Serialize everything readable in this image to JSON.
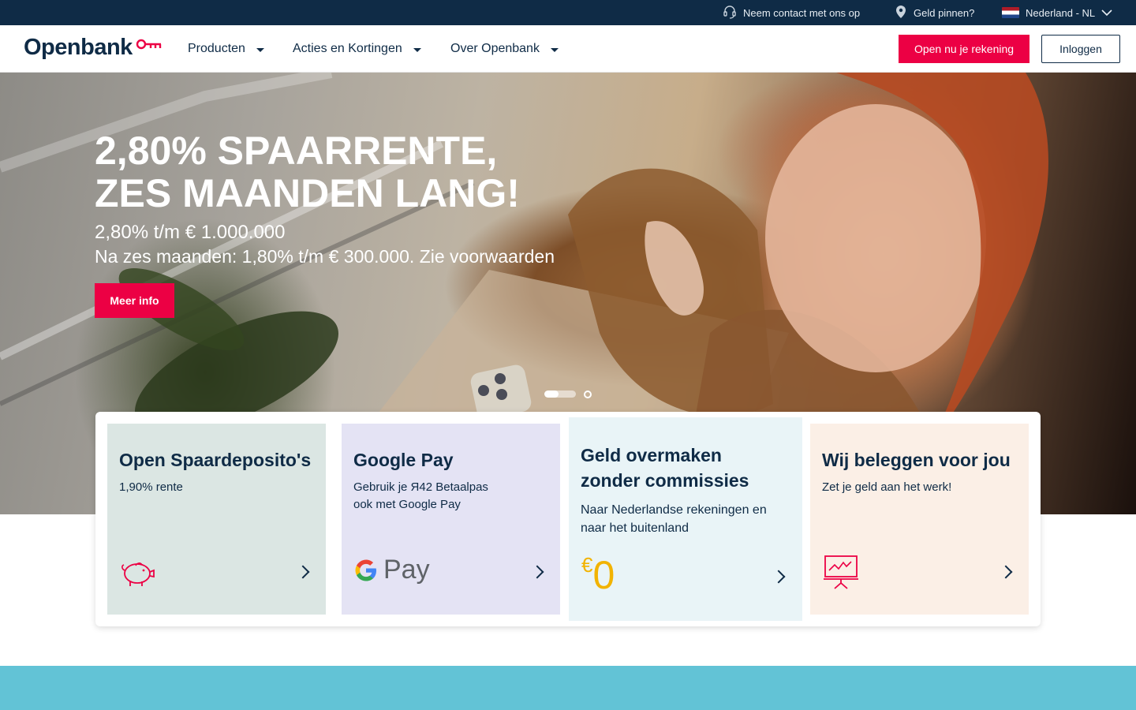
{
  "topbar": {
    "contact": "Neem contact met ons op",
    "atm": "Geld pinnen?",
    "language": "Nederland - NL"
  },
  "header": {
    "logo": "Openbank",
    "nav": [
      {
        "label": "Producten"
      },
      {
        "label": "Acties en Kortingen"
      },
      {
        "label": "Over Openbank"
      }
    ],
    "open_account": "Open nu je rekening",
    "login": "Inloggen"
  },
  "hero": {
    "title_line1": "2,80% SPAARRENTE,",
    "title_line2": "ZES MAANDEN LANG!",
    "subtitle1": "2,80% t/m € 1.000.000",
    "subtitle2": "Na zes maanden: 1,80% t/m € 300.000. Zie voorwaarden",
    "cta": "Meer info",
    "slides": 2,
    "active_slide": 1
  },
  "cards": [
    {
      "title": "Open Spaardeposito's",
      "text": "1,90% rente",
      "icon": "piggy-bank-icon"
    },
    {
      "title": "Google Pay",
      "text_line1": "Gebruik je Я42 Betaalpas",
      "text_line2": "ook met Google Pay",
      "logo_text": "Pay",
      "icon": "google-pay-icon"
    },
    {
      "title_line1": "Geld overmaken",
      "title_line2": "zonder commissies",
      "text_line1": "Naar Nederlandse rekeningen en",
      "text_line2": "naar het buitenland",
      "currency": "€",
      "amount": "0"
    },
    {
      "title": "Wij beleggen voor jou",
      "text": "Zet je geld aan het werk!",
      "icon": "presentation-chart-icon"
    }
  ],
  "colors": {
    "brand_navy": "#0f2b46",
    "brand_red": "#ec0044",
    "card1_bg": "#dbe6e3",
    "card2_bg": "#e4e3f4",
    "card3_bg": "#e9f4f7",
    "card4_bg": "#fbefe6",
    "accent_yellow": "#f2b300",
    "band_teal": "#62c3d6"
  }
}
